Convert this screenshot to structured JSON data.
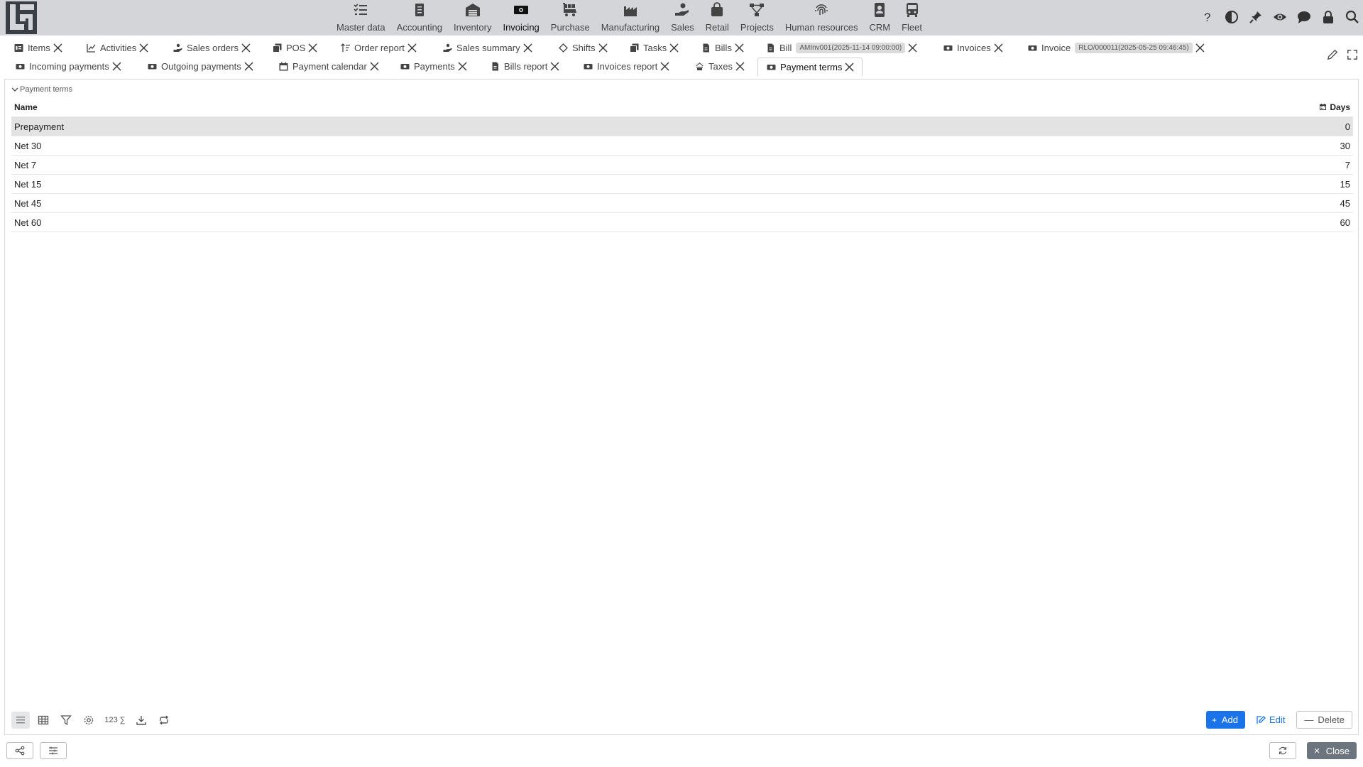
{
  "topbar": {
    "modules": [
      {
        "label": "Master data",
        "icon": "checklist-icon"
      },
      {
        "label": "Accounting",
        "icon": "ledger-icon"
      },
      {
        "label": "Inventory",
        "icon": "warehouse-icon"
      },
      {
        "label": "Invoicing",
        "icon": "banknote-icon"
      },
      {
        "label": "Purchase",
        "icon": "cart-icon"
      },
      {
        "label": "Manufacturing",
        "icon": "factory-icon"
      },
      {
        "label": "Sales",
        "icon": "hand-coin-icon"
      },
      {
        "label": "Retail",
        "icon": "shopping-bag-icon"
      },
      {
        "label": "Projects",
        "icon": "diagram-icon"
      },
      {
        "label": "Human resources",
        "icon": "fingerprint-icon"
      },
      {
        "label": "CRM",
        "icon": "contact-book-icon"
      },
      {
        "label": "Fleet",
        "icon": "bus-icon"
      }
    ],
    "active_module": "Invoicing"
  },
  "tabs": {
    "row1": [
      {
        "label": "Items",
        "icon": "item-icon"
      },
      {
        "label": "Activities",
        "icon": "chart-line-icon"
      },
      {
        "label": "Sales orders",
        "icon": "hand-coin-icon"
      },
      {
        "label": "POS",
        "icon": "copy-icon"
      },
      {
        "label": "Order report",
        "icon": "sort-icon"
      },
      {
        "label": "Sales summary",
        "icon": "hand-coin-icon"
      },
      {
        "label": "Shifts",
        "icon": "diamond-icon"
      },
      {
        "label": "Tasks",
        "icon": "copy-icon"
      },
      {
        "label": "Bills",
        "icon": "document-icon"
      },
      {
        "label": "Bill",
        "icon": "document-icon",
        "badge": "AMInv001(2025-11-14 09:00:00)"
      },
      {
        "label": "Invoices",
        "icon": "banknote-icon"
      },
      {
        "label": "Invoice",
        "icon": "banknote-icon",
        "badge": "RLO/000011(2025-05-25 09:46:45)"
      }
    ],
    "row2": [
      {
        "label": "Incoming payments",
        "icon": "banknote-icon"
      },
      {
        "label": "Outgoing payments",
        "icon": "banknote-icon"
      },
      {
        "label": "Payment calendar",
        "icon": "calendar-icon"
      },
      {
        "label": "Payments",
        "icon": "banknote-icon"
      },
      {
        "label": "Bills report",
        "icon": "document-icon"
      },
      {
        "label": "Invoices report",
        "icon": "banknote-icon"
      },
      {
        "label": "Taxes",
        "icon": "tax-icon"
      },
      {
        "label": "Payment terms",
        "icon": "banknote-icon"
      }
    ],
    "active_tab": "Payment terms"
  },
  "panel": {
    "section_title": "Payment terms",
    "columns": {
      "name": "Name",
      "days": "Days"
    },
    "rows": [
      {
        "name": "Prepayment",
        "days": "0"
      },
      {
        "name": "Net 30",
        "days": "30"
      },
      {
        "name": "Net 7",
        "days": "7"
      },
      {
        "name": "Net 15",
        "days": "15"
      },
      {
        "name": "Net 45",
        "days": "45"
      },
      {
        "name": "Net 60",
        "days": "60"
      }
    ],
    "toolbar": {
      "sum_label": "123 ∑"
    },
    "actions": {
      "add": "Add",
      "edit": "Edit",
      "delete": "Delete"
    }
  },
  "footer": {
    "close": "Close"
  },
  "colors": {
    "accent": "#1a73e8",
    "topbar_bg": "#d3d5d8",
    "selected_row": "#e3e3e3",
    "close_btn": "#6c757d"
  }
}
